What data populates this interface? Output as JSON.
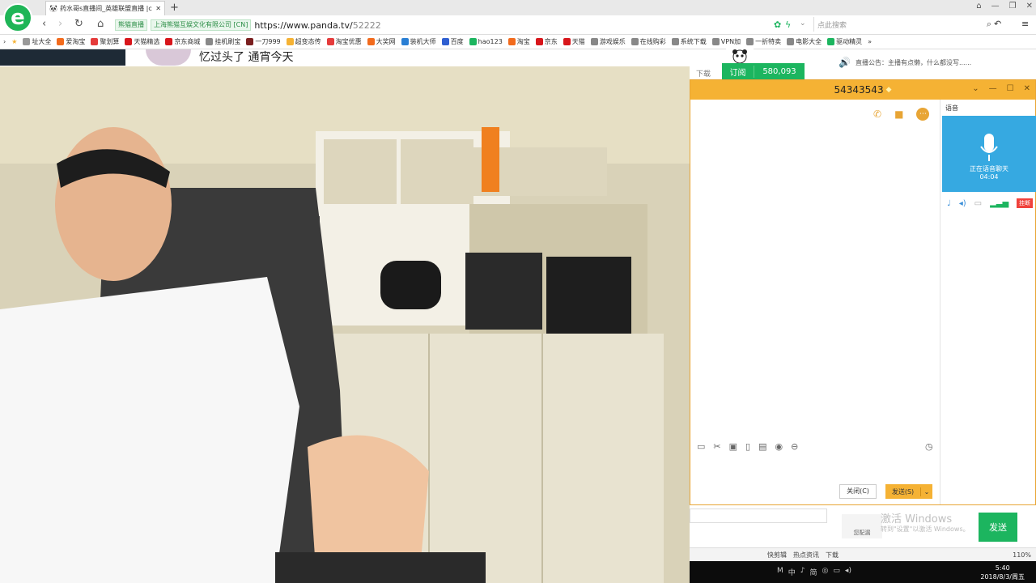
{
  "browser": {
    "tab_title": "药水哥s直播间_英雄联盟直播 |c",
    "site_chip": "熊猫直播",
    "org_chip": "上海熊猫互娱文化有限公司 [CN]",
    "url_host": "https://www.panda.tv/",
    "url_path": "52222",
    "search_placeholder": "点此搜索"
  },
  "bookmarks": [
    "址大全",
    "爱淘宝",
    "聚划算",
    "天猫精选",
    "京东商城",
    "挂机刷宝",
    "一刀999",
    "超变态传",
    "淘宝优惠",
    "大奖网",
    "装机大师",
    "百度",
    "hao123",
    "淘宝",
    "京东",
    "天猫",
    "游戏娱乐",
    "在线购彩",
    "系统下载",
    "VPN加",
    "一折特卖",
    "电影大全",
    "驱动精灵"
  ],
  "stream": {
    "title_fragment": "忆过头了 通宵今天",
    "download_label": "下载",
    "subscribe_label": "订阅",
    "subscriber_count": "580,093",
    "notice": "直播公告：主播有点懒，什么都没写......"
  },
  "chat_window": {
    "id_title": "54343543",
    "toolbar_icons": [
      "folder-icon",
      "screenshot-icon",
      "image-icon",
      "phone-icon",
      "file-icon",
      "record-icon",
      "remove-icon"
    ],
    "close_label": "关闭(C)",
    "send_label": "发送(S)",
    "voice": {
      "tab_label": "语音",
      "status": "正在语音聊天",
      "timer": "04:04",
      "hangup_label": "挂断"
    }
  },
  "page_chat": {
    "gift_label": "您配漏",
    "activation_title": "激活 Windows",
    "activation_sub": "转到\"设置\"以激活 Windows。",
    "send_label": "发送"
  },
  "statusbar": {
    "items": [
      "快剪辑",
      "热点资讯",
      "下载"
    ],
    "zoom": "110%"
  },
  "taskbar": {
    "icons": [
      "M",
      "中",
      "♪",
      "简"
    ],
    "time": "5:40",
    "date": "2018/8/3/周五"
  },
  "colors": {
    "accent_green": "#1cb55f",
    "chat_orange": "#f5b234",
    "voice_blue": "#36a9e1",
    "hangup_red": "#f0423c"
  }
}
